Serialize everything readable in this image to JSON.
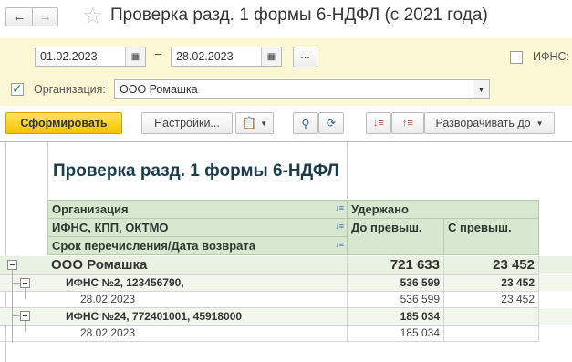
{
  "window": {
    "title": "Проверка разд. 1 формы 6-НДФЛ (с 2021 года)"
  },
  "filters": {
    "date_from": "01.02.2023",
    "dash": "–",
    "date_to": "28.02.2023",
    "dots_label": "...",
    "ifns_label": "ИФНС:",
    "org_label": "Организация:",
    "org_value": "ООО Ромашка"
  },
  "toolbar": {
    "generate_label": "Сформировать",
    "settings_label": "Настройки...",
    "expand_label": "Разворачивать до"
  },
  "report": {
    "title": "Проверка разд. 1 формы 6-НДФЛ",
    "headers": {
      "org": "Организация",
      "ifns": "ИФНС, КПП, ОКТМО",
      "term": "Срок перечисления/Дата возврата",
      "withheld": "Удержано",
      "before": "До превыш.",
      "after": "С превыш."
    },
    "rows": [
      {
        "label": "ООО Ромашка",
        "before": "721 633",
        "after": "23 452"
      },
      {
        "label": "ИФНС №2, 123456790,",
        "before": "536 599",
        "after": "23 452"
      },
      {
        "label": "28.02.2023",
        "before": "536 599",
        "after": "23 452"
      },
      {
        "label": "ИФНС №24, 772401001, 45918000",
        "before": "185 034",
        "after": ""
      },
      {
        "label": "28.02.2023",
        "before": "185 034",
        "after": ""
      }
    ]
  },
  "colors": {
    "filter_bg": "#fcf7d5",
    "header_bg": "#d8e7d0",
    "total_bg": "#e9f1e3",
    "group_bg": "#f2f7ee",
    "primary_btn": "#f2c300"
  }
}
